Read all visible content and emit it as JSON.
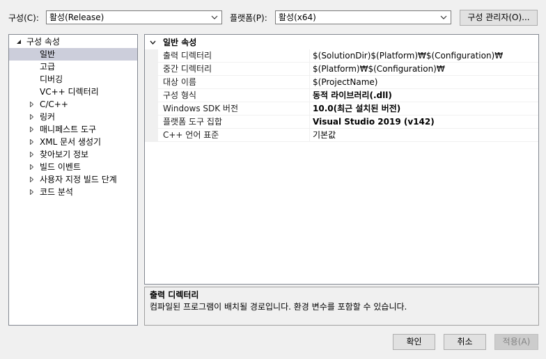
{
  "header": {
    "config_label": "구성(C):",
    "config_value": "활성(Release)",
    "platform_label": "플랫폼(P):",
    "platform_value": "활성(x64)",
    "config_manager_label": "구성 관리자(O)..."
  },
  "tree": {
    "root": "구성 속성",
    "items": [
      {
        "label": "일반",
        "selected": true,
        "expandable": false
      },
      {
        "label": "고급",
        "expandable": false
      },
      {
        "label": "디버깅",
        "expandable": false
      },
      {
        "label": "VC++ 디렉터리",
        "expandable": false
      },
      {
        "label": "C/C++",
        "expandable": true
      },
      {
        "label": "링커",
        "expandable": true
      },
      {
        "label": "매니페스트 도구",
        "expandable": true
      },
      {
        "label": "XML 문서 생성기",
        "expandable": true
      },
      {
        "label": "찾아보기 정보",
        "expandable": true
      },
      {
        "label": "빌드 이벤트",
        "expandable": true
      },
      {
        "label": "사용자 지정 빌드 단계",
        "expandable": true
      },
      {
        "label": "코드 분석",
        "expandable": true
      }
    ]
  },
  "grid": {
    "category": "일반 속성",
    "properties": [
      {
        "name": "출력 디렉터리",
        "value": "$(SolutionDir)$(Platform)₩$(Configuration)₩",
        "bold": false
      },
      {
        "name": "중간 디렉터리",
        "value": "$(Platform)₩$(Configuration)₩",
        "bold": false
      },
      {
        "name": "대상 이름",
        "value": "$(ProjectName)",
        "bold": false
      },
      {
        "name": "구성 형식",
        "value": "동적 라이브러리(.dll)",
        "bold": true
      },
      {
        "name": "Windows SDK 버전",
        "value": "10.0(최근 설치된 버전)",
        "bold": true
      },
      {
        "name": "플랫폼 도구 집합",
        "value": "Visual Studio 2019 (v142)",
        "bold": true
      },
      {
        "name": "C++ 언어 표준",
        "value": "기본값",
        "bold": false
      }
    ]
  },
  "description": {
    "title": "출력 디렉터리",
    "text": "컴파일된 프로그램이 배치될 경로입니다. 환경 변수를 포함할 수 있습니다."
  },
  "buttons": {
    "ok": "확인",
    "cancel": "취소",
    "apply": "적용(A)"
  },
  "colors": {
    "selection": "#cccedb",
    "background": "#f0f0f0"
  }
}
